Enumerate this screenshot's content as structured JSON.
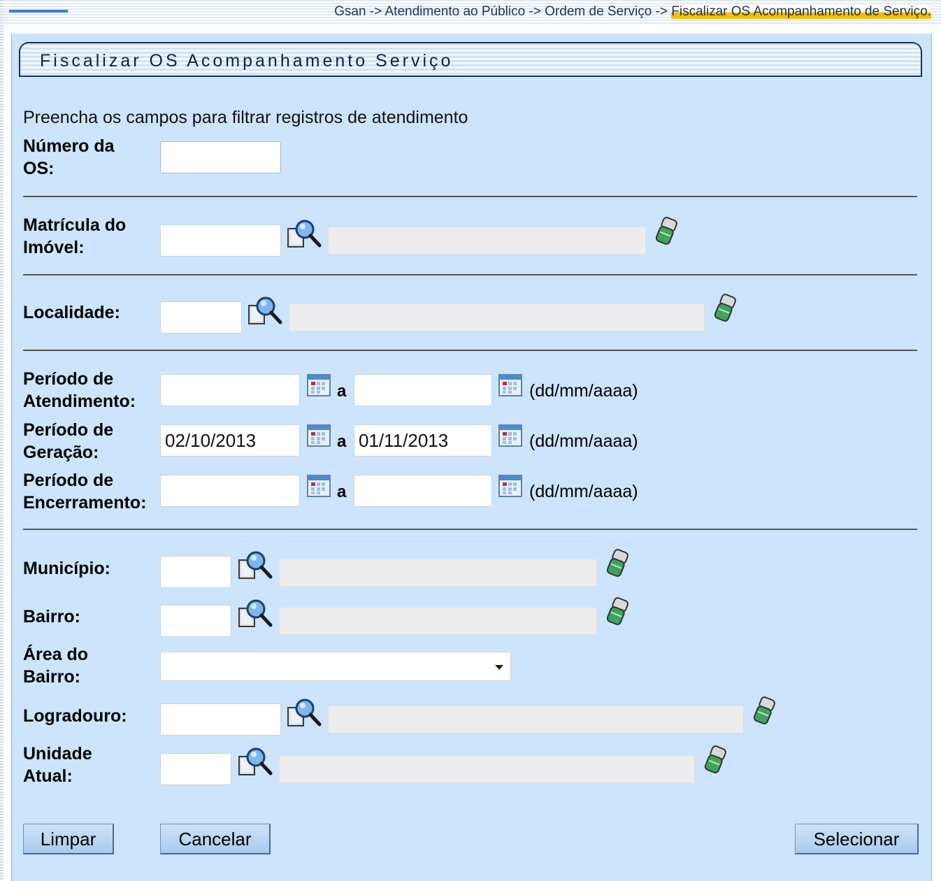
{
  "breadcrumb": {
    "prefix": "Gsan -> Atendimento ao Público -> Ordem de Serviço -> ",
    "current": "Fiscalizar OS Acompanhamento de Serviço."
  },
  "title": "Fiscalizar OS Acompanhamento Serviço",
  "hint": "Preencha os campos para filtrar registros de atendimento",
  "labels": {
    "numero_os_1": "Número da",
    "numero_os_2": "OS:",
    "matricula_1": "Matrícula do",
    "matricula_2": "Imóvel:",
    "localidade": "Localidade:",
    "atendimento_1": "Período de",
    "atendimento_2": "Atendimento:",
    "geracao_1": "Período de",
    "geracao_2": "Geração:",
    "encerramento_1": "Período de",
    "encerramento_2": "Encerramento:",
    "municipio": "Município:",
    "bairro": "Bairro:",
    "area_1": "Área do",
    "area_2": "Bairro:",
    "logradouro": "Logradouro:",
    "unidade_1": "Unidade",
    "unidade_2": "Atual:"
  },
  "fields": {
    "numero_os": "",
    "matricula": "",
    "localidade": "",
    "atendimento_inicio": "",
    "atendimento_fim": "",
    "geracao_inicio": "02/10/2013",
    "geracao_fim": "01/11/2013",
    "encerramento_inicio": "",
    "encerramento_fim": "",
    "municipio": "",
    "bairro": "",
    "area_bairro": "",
    "logradouro": "",
    "unidade": ""
  },
  "range_separator": "a",
  "date_format": "(dd/mm/aaaa)",
  "buttons": {
    "limpar": "Limpar",
    "cancelar": "Cancelar",
    "selecionar": "Selecionar"
  },
  "icons": {
    "search": "search-icon",
    "eraser": "eraser-icon",
    "calendar": "calendar-icon"
  },
  "colors": {
    "panel": "#cce5fc",
    "title_border": "#1a2f5c",
    "button": "#a9cbee"
  }
}
